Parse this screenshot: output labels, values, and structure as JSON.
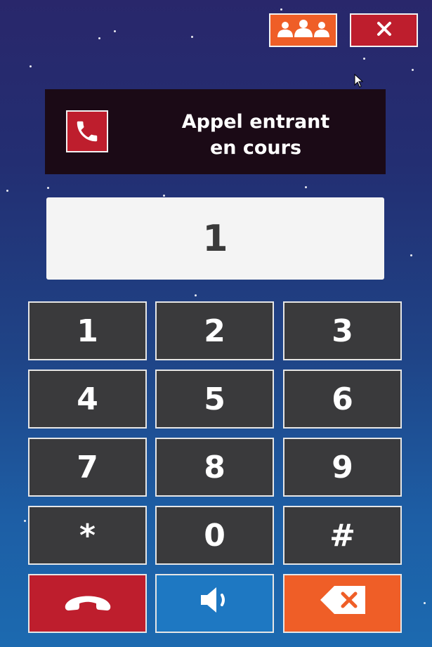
{
  "header": {
    "contacts_icon": "group-icon",
    "close_icon": "close-icon"
  },
  "banner": {
    "icon": "phone-icon",
    "line1": "Appel entrant",
    "line2": "en cours"
  },
  "display": {
    "number": "1"
  },
  "keypad": {
    "keys": [
      "1",
      "2",
      "3",
      "4",
      "5",
      "6",
      "7",
      "8",
      "9",
      "*",
      "0",
      "#"
    ]
  },
  "actions": {
    "hangup_icon": "hangup-icon",
    "speaker_icon": "speaker-icon",
    "backspace_icon": "backspace-icon"
  },
  "colors": {
    "orange": "#ef5e27",
    "red": "#be1e2d",
    "blue": "#1e78c2",
    "key_bg": "#3a3a3c",
    "banner_bg": "#1b0a16",
    "display_bg": "#f4f4f4"
  }
}
